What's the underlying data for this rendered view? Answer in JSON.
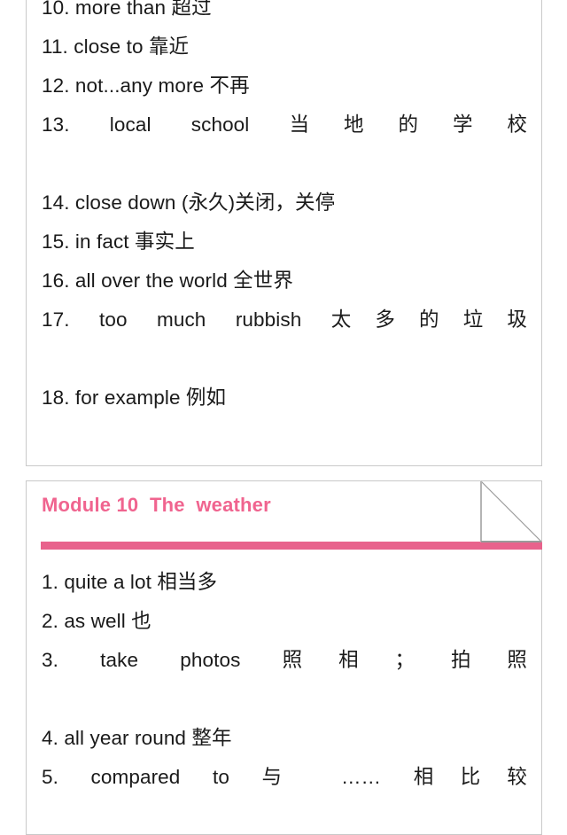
{
  "document": {
    "type": "study-notes-phrase-list",
    "background_color": "#ffffff",
    "card_border_color": "#c9c9c9",
    "text_color": "#1a1a1a"
  },
  "top_card": {
    "name": "previous-module-phrase-list",
    "items": [
      {
        "num": "10.",
        "english": "more than",
        "chinese": "超过",
        "justified": false,
        "text": "10. more than  超过"
      },
      {
        "num": "11.",
        "english": "close to",
        "chinese": "靠近",
        "justified": false,
        "text": "11. close to  靠近"
      },
      {
        "num": "12.",
        "english": "not...any more",
        "chinese": "不再",
        "justified": false,
        "text": "12. not...any more  不再"
      },
      {
        "num": "13.",
        "english": "local school",
        "chinese": "当地的学校",
        "justified": true,
        "text": "13. local school 当地的学校"
      },
      {
        "num": "14.",
        "english": "close down",
        "chinese": "(永久)关闭，关停",
        "justified": false,
        "text": "14. close down  (永久)关闭，关停"
      },
      {
        "num": "15.",
        "english": "in fact",
        "chinese": "事实上",
        "justified": false,
        "text": "15. in fact  事实上"
      },
      {
        "num": "16.",
        "english": "all over the world",
        "chinese": "全世界",
        "justified": false,
        "text": "16. all over the world  全世界"
      },
      {
        "num": "17.",
        "english": "too much rubbish",
        "chinese": "太多的垃圾",
        "justified": true,
        "text": "17. too much rubbish 太多的垃圾"
      },
      {
        "num": "18.",
        "english": "for example",
        "chinese": "例如",
        "justified": false,
        "text": "18. for example  例如"
      }
    ]
  },
  "module_card": {
    "name": "module-10-card",
    "title": "Module 10  The  weather",
    "title_color": "#f0648f",
    "rule_color": "#e8628c",
    "fold_icon": "page-fold-corner-icon",
    "items": [
      {
        "num": "1.",
        "english": "quite a lot",
        "chinese": "相当多",
        "justified": false,
        "text": "1. quite a lot  相当多"
      },
      {
        "num": "2.",
        "english": "as well",
        "chinese": "也",
        "justified": false,
        "text": "2. as well  也"
      },
      {
        "num": "3.",
        "english": "take photos",
        "chinese": "照相；拍照",
        "justified": true,
        "text": "3. take photos 照相；拍照"
      },
      {
        "num": "4.",
        "english": "all year round",
        "chinese": "整年",
        "justified": false,
        "text": "4. all year round  整年"
      },
      {
        "num": "5.",
        "english": "compared to",
        "chinese": "与……相比较",
        "justified": true,
        "text": "5. compared to 与 …… 相比较"
      }
    ]
  }
}
